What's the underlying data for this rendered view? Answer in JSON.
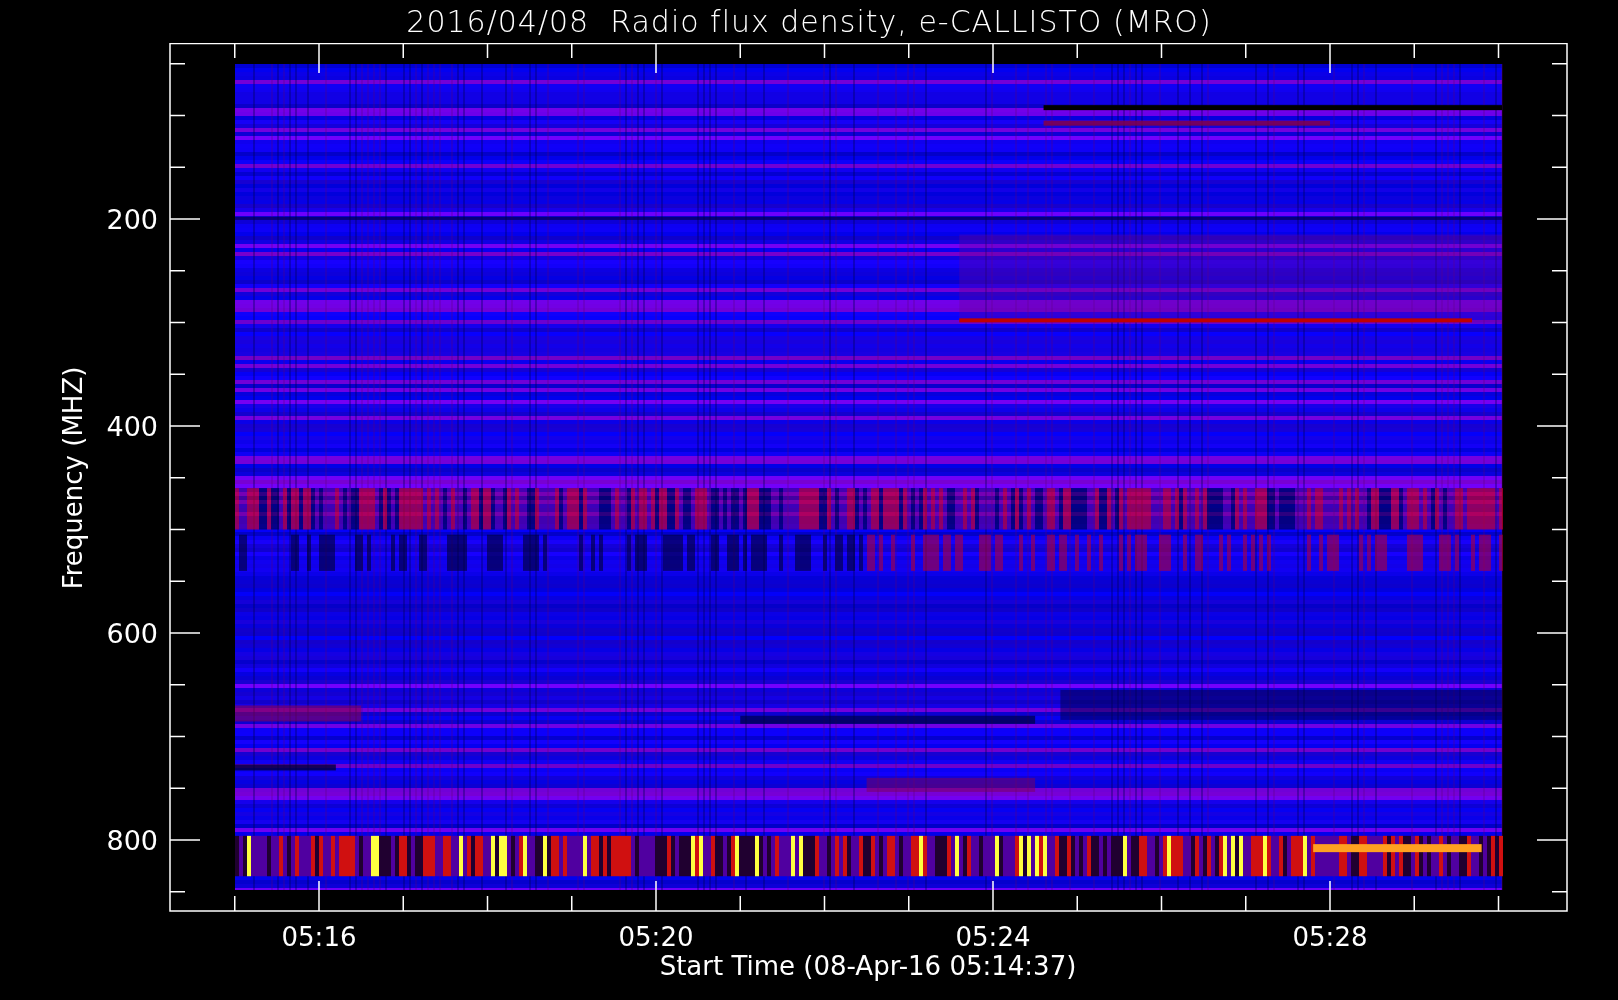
{
  "plot": {
    "title": "2016/04/08  Radio flux density, e-CALLISTO (MRO)",
    "xlabel": "Start Time (08-Apr-16 05:14:37)",
    "ylabel": "Frequency (MHZ)",
    "y_tick_labels": [
      "200",
      "400",
      "600",
      "800"
    ],
    "x_tick_labels": [
      "05:16",
      "05:20",
      "05:24",
      "05:28"
    ]
  }
}
